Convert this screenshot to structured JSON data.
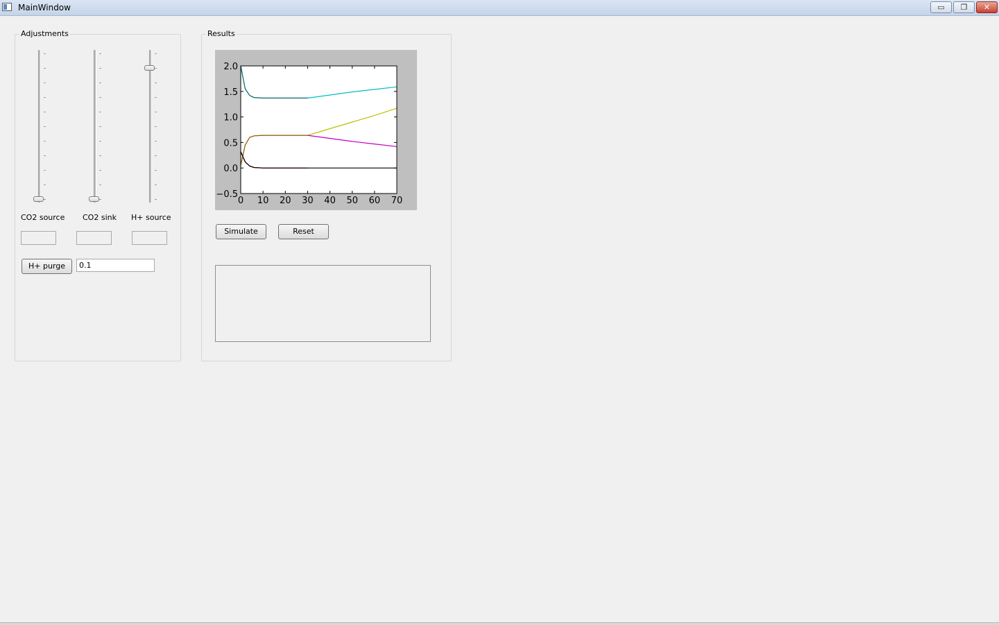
{
  "window": {
    "title": "MainWindow",
    "minimize_glyph": "▭",
    "maximize_glyph": "❐",
    "close_glyph": "✕"
  },
  "adjustments": {
    "group_title": "Adjustments",
    "sliders": [
      {
        "label": "CO2 source",
        "level": 0.0,
        "input_value": ""
      },
      {
        "label": "CO2 sink",
        "level": 0.0,
        "input_value": ""
      },
      {
        "label": "H+ source",
        "level": 0.9,
        "input_value": ""
      }
    ],
    "purge_button_label": "H+ purge",
    "purge_value": "0.1"
  },
  "results": {
    "group_title": "Results",
    "simulate_label": "Simulate",
    "reset_label": "Reset",
    "output_text": ""
  },
  "chart_data": {
    "type": "line",
    "title": "",
    "xlabel": "",
    "ylabel": "",
    "xlim": [
      0,
      70
    ],
    "ylim": [
      -0.5,
      2.0
    ],
    "xticks": [
      "0",
      "10",
      "20",
      "30",
      "40",
      "50",
      "60",
      "70"
    ],
    "yticks": [
      "−0.5",
      "0.0",
      "0.5",
      "1.0",
      "1.5",
      "2.0"
    ],
    "grid": false,
    "series": [
      {
        "color": "#00bfbf",
        "x": [
          0,
          2,
          4,
          6,
          10,
          20,
          30,
          40,
          50,
          60,
          70
        ],
        "y": [
          2.0,
          1.55,
          1.42,
          1.38,
          1.37,
          1.37,
          1.37,
          1.43,
          1.49,
          1.54,
          1.59
        ]
      },
      {
        "color": "#1a6e6e",
        "x": [
          0,
          2,
          4,
          6,
          10,
          20,
          30
        ],
        "y": [
          2.0,
          1.55,
          1.42,
          1.38,
          1.37,
          1.37,
          1.37
        ]
      },
      {
        "color": "#bfbf00",
        "x": [
          0,
          2,
          4,
          6,
          10,
          20,
          30,
          40,
          50,
          60,
          70
        ],
        "y": [
          0.05,
          0.45,
          0.6,
          0.63,
          0.64,
          0.64,
          0.64,
          0.77,
          0.9,
          1.03,
          1.17
        ]
      },
      {
        "color": "#8b5a1a",
        "x": [
          0,
          2,
          4,
          6,
          10,
          20,
          30
        ],
        "y": [
          0.05,
          0.45,
          0.6,
          0.63,
          0.64,
          0.64,
          0.64
        ]
      },
      {
        "color": "#bf00bf",
        "x": [
          30,
          40,
          50,
          60,
          70
        ],
        "y": [
          0.64,
          0.58,
          0.52,
          0.47,
          0.42
        ]
      },
      {
        "color": "#cc0000",
        "x": [
          0,
          2,
          4,
          6,
          10,
          20,
          30
        ],
        "y": [
          0.32,
          0.12,
          0.04,
          0.01,
          0.0,
          0.0,
          0.0
        ]
      },
      {
        "color": "#000000",
        "x": [
          0,
          2,
          4,
          6,
          10,
          20,
          30,
          40,
          50,
          60,
          70
        ],
        "y": [
          0.32,
          0.12,
          0.04,
          0.01,
          0.0,
          0.0,
          0.0,
          0.0,
          0.0,
          0.0,
          0.0
        ]
      }
    ]
  }
}
